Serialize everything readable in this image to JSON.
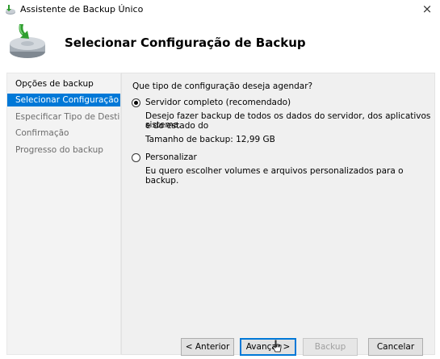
{
  "window": {
    "title": "Assistente de Backup Único",
    "close_glyph": "×",
    "app_icon": "backup-drive-icon"
  },
  "header": {
    "heading": "Selecionar Configuração de Backup",
    "icon": "backup-drive-large-icon"
  },
  "sidebar": {
    "items": [
      {
        "label": "Opções de backup",
        "state": "normal"
      },
      {
        "label": "Selecionar Configuração ...",
        "state": "selected"
      },
      {
        "label": "Especificar Tipo de Destino",
        "state": "disabled"
      },
      {
        "label": "Confirmação",
        "state": "disabled"
      },
      {
        "label": "Progresso do backup",
        "state": "disabled"
      }
    ]
  },
  "main": {
    "question": "Que tipo de configuração deseja agendar?",
    "options": [
      {
        "label": "Servidor completo (recomendado)",
        "checked": true,
        "description_line1": "Desejo fazer backup de todos os dados do servidor, dos aplicativos e do estado do",
        "description_line2": "sistema.",
        "size_text": "Tamanho de backup: 12,99 GB"
      },
      {
        "label": "Personalizar",
        "checked": false,
        "description_line1": "Eu quero escolher volumes e arquivos personalizados para o backup."
      }
    ]
  },
  "buttons": {
    "previous": "< Anterior",
    "next": "Avançar >",
    "backup": "Backup",
    "cancel": "Cancelar"
  },
  "colors": {
    "selection": "#0078d7",
    "focus": "#0078d7"
  }
}
